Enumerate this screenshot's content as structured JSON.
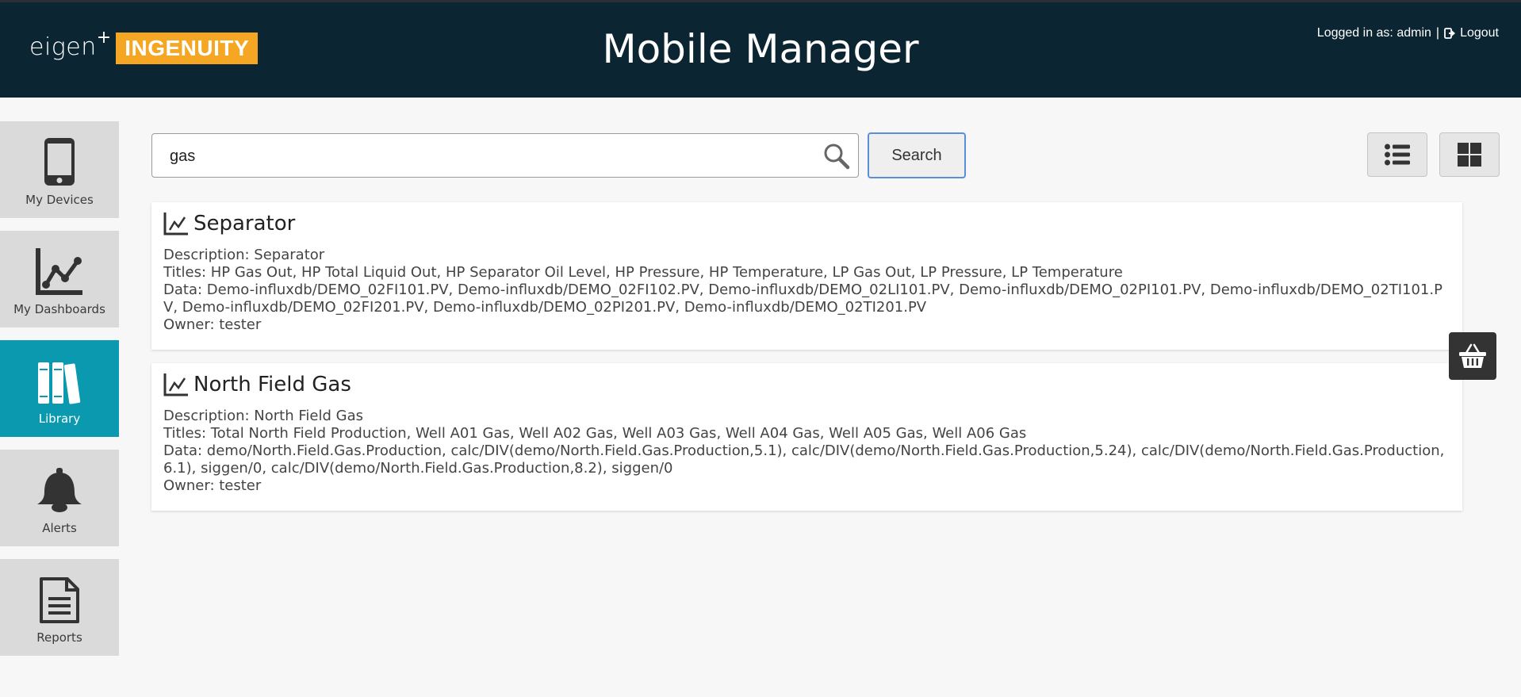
{
  "header": {
    "logo_eigen": "eigen",
    "logo_plus": "+",
    "logo_brand": "INGENUITY",
    "title": "Mobile Manager",
    "logged_in_text": "Logged in as: admin",
    "separator": "|",
    "logout_label": "Logout"
  },
  "nav": {
    "items": [
      {
        "label": "My Devices",
        "icon": "mobile-phone-icon"
      },
      {
        "label": "My Dashboards",
        "icon": "line-chart-icon"
      },
      {
        "label": "Library",
        "icon": "books-icon",
        "active": true
      },
      {
        "label": "Alerts",
        "icon": "bell-icon"
      },
      {
        "label": "Reports",
        "icon": "document-icon"
      }
    ]
  },
  "search": {
    "value": "gas",
    "placeholder": "",
    "button_label": "Search"
  },
  "results": [
    {
      "title": "Separator",
      "description": "Description: Separator",
      "titles": "Titles: HP Gas Out, HP Total Liquid Out, HP Separator Oil Level, HP Pressure, HP Temperature, LP Gas Out, LP Pressure, LP Temperature",
      "data": "Data: Demo-influxdb/DEMO_02FI101.PV, Demo-influxdb/DEMO_02FI102.PV, Demo-influxdb/DEMO_02LI101.PV, Demo-influxdb/DEMO_02PI101.PV, Demo-influxdb/DEMO_02TI101.PV, Demo-influxdb/DEMO_02FI201.PV, Demo-influxdb/DEMO_02PI201.PV, Demo-influxdb/DEMO_02TI201.PV",
      "owner": "Owner: tester"
    },
    {
      "title": "North Field Gas",
      "description": "Description: North Field Gas",
      "titles": "Titles: Total North Field Production, Well A01 Gas, Well A02 Gas, Well A03 Gas, Well A04 Gas, Well A05 Gas, Well A06 Gas",
      "data": "Data: demo/North.Field.Gas.Production, calc/DIV(demo/North.Field.Gas.Production,5.1), calc/DIV(demo/North.Field.Gas.Production,5.24), calc/DIV(demo/North.Field.Gas.Production,6.1), siggen/0, calc/DIV(demo/North.Field.Gas.Production,8.2), siggen/0",
      "owner": "Owner: tester"
    }
  ],
  "colors": {
    "header_bg": "#0b2532",
    "brand_orange": "#f5a623",
    "nav_active": "#0a99ae",
    "nav_inactive": "#dadada"
  }
}
